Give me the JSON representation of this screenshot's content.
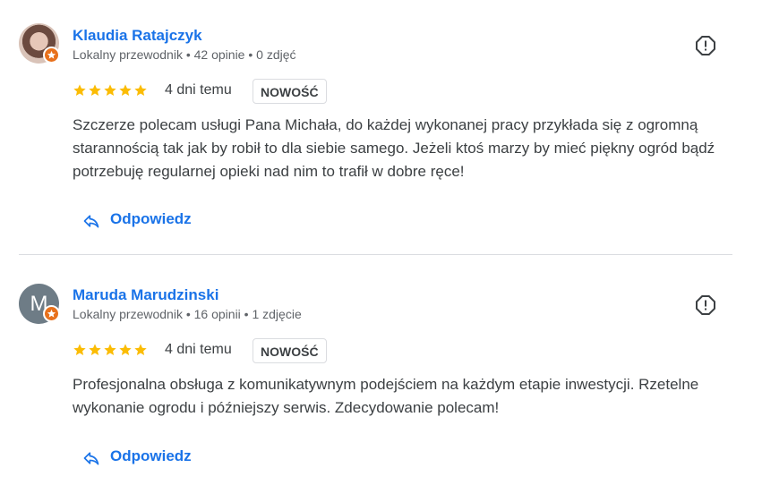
{
  "reviews": [
    {
      "author": "Klaudia Ratajczyk",
      "meta": "Lokalny przewodnik • 42 opinie • 0 zdjęć",
      "rating": 5,
      "time": "4 dni temu",
      "badge": "NOWOŚĆ",
      "text": "Szczerze polecam usługi Pana Michała, do każdej wykonanej pracy przykłada się z ogromną starannością tak jak by robił to dla siebie samego. Jeżeli ktoś marzy by mieć piękny ogród bądź potrzebuję regularnej opieki nad nim to trafił w dobre ręce!",
      "reply_label": "Odpowiedz",
      "avatar_icon": "profile-photo",
      "flag_icon": "report-icon"
    },
    {
      "author": "Maruda Marudzinski",
      "avatar_letter": "M",
      "meta": "Lokalny przewodnik • 16 opinii • 1 zdjęcie",
      "rating": 5,
      "time": "4 dni temu",
      "badge": "NOWOŚĆ",
      "text": "Profesjonalna obsługa z komunikatywnym podejściem na każdym etapie inwestycji. Rzetelne wykonanie ogrodu i późniejszy serwis. Zdecydowanie polecam!",
      "reply_label": "Odpowiedz",
      "avatar_icon": "letter-avatar",
      "flag_icon": "report-icon"
    }
  ],
  "colors": {
    "link_blue": "#1a73e8",
    "star_yellow": "#fbbc04",
    "local_guide_orange": "#e8711c"
  }
}
